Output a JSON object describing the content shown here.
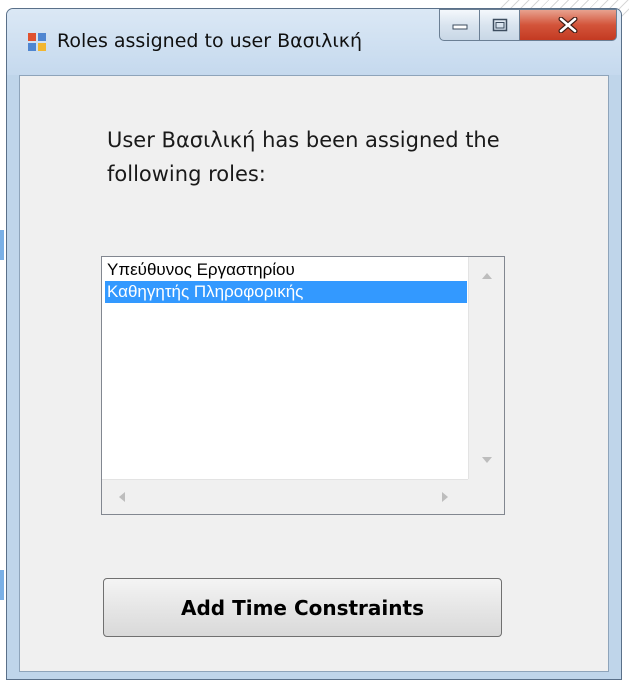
{
  "window": {
    "title": "Roles assigned to user Βασιλική",
    "accent_close": "#c33a22",
    "frame_color": "#bfd5ea"
  },
  "dialog": {
    "description": "User Βασιλική has been assigned the following roles:"
  },
  "roles_list": {
    "items": [
      {
        "label": "Υπεύθυνος Εργαστηρίου",
        "selected": false
      },
      {
        "label": "Καθηγητής Πληροφορικής",
        "selected": true
      }
    ],
    "selection_color": "#3399ff"
  },
  "actions": {
    "add_time_constraints_label": "Add Time Constraints"
  },
  "icons": [
    "app-form-icon",
    "minimize-icon",
    "maximize-icon",
    "close-icon",
    "scroll-up-icon",
    "scroll-down-icon",
    "scroll-left-icon",
    "scroll-right-icon"
  ]
}
